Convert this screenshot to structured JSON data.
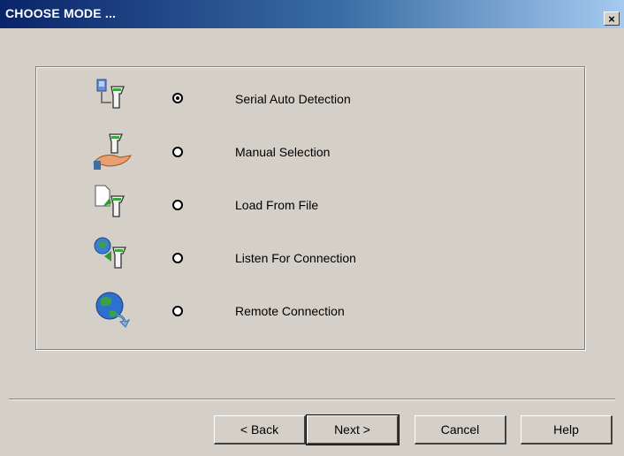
{
  "window": {
    "title": "CHOOSE MODE ...",
    "close_label": "×"
  },
  "options": [
    {
      "label": "Serial Auto Detection",
      "icon": "serial-scanner-icon",
      "selected": true
    },
    {
      "label": "Manual Selection",
      "icon": "hand-scanner-icon",
      "selected": false
    },
    {
      "label": "Load From File",
      "icon": "file-scanner-icon",
      "selected": false
    },
    {
      "label": "Listen For Connection",
      "icon": "network-scanner-icon",
      "selected": false
    },
    {
      "label": "Remote Connection",
      "icon": "globe-icon",
      "selected": false
    }
  ],
  "buttons": {
    "back": "< Back",
    "next": "Next >",
    "cancel": "Cancel",
    "help": "Help"
  },
  "colors": {
    "face": "#d4d0c8",
    "title_start": "#0a246a",
    "title_end": "#a6caf0"
  }
}
